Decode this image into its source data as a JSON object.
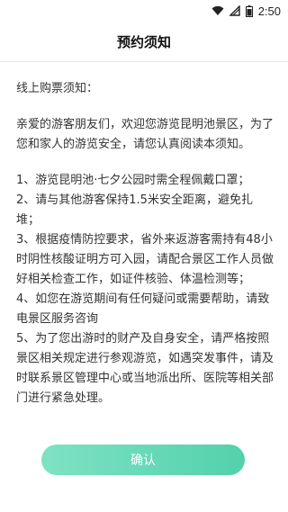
{
  "status_bar": {
    "time": "2:50",
    "icons": [
      "wifi-icon",
      "signal-icon",
      "battery-icon"
    ]
  },
  "header": {
    "title": "预约须知"
  },
  "notice": {
    "intro": "线上购票须知：",
    "greeting": "亲爱的游客朋友们，欢迎您游览昆明池景区，为了您和家人的游览安全，请您认真阅读本须知。",
    "rules": [
      "1、游览昆明池·七夕公园时需全程佩戴口罩；",
      "2、请与其他游客保持1.5米安全距离，避免扎堆；",
      "3、根据疫情防控要求，省外来返游客需持有48小时阴性核酸证明方可入园，请配合景区工作人员做好相关检查工作，如证件核验、体温检测等；",
      "4、如您在游览期间有任何疑问或需要帮助，请致电景区服务咨询",
      "5、为了您出游时的财产及自身安全，请严格按照景区相关规定进行参观游览，如遇突发事件，请及时联系景区管理中心或当地派出所、医院等相关部门进行紧急处理。"
    ]
  },
  "footer": {
    "confirm_label": "确认"
  },
  "colors": {
    "accent_start": "#7fe2c3",
    "accent_end": "#52d1ab"
  }
}
